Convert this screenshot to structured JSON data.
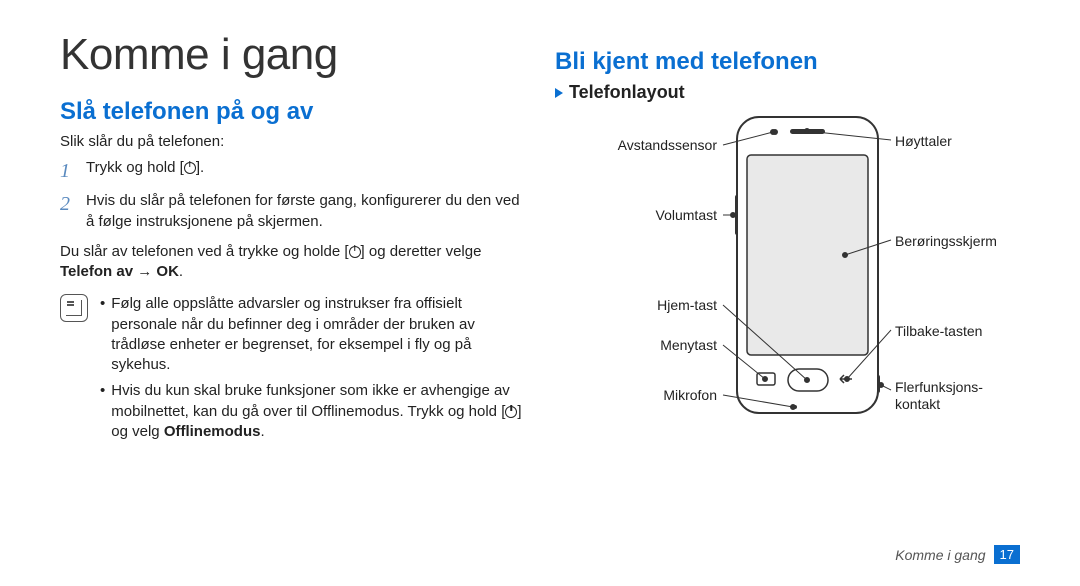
{
  "header": {
    "title": "Komme i gang"
  },
  "left": {
    "section_title": "Slå telefonen på og av",
    "intro": "Slik slår du på telefonen:",
    "step1": "Trykk og hold [",
    "step1_after": "].",
    "step2": "Hvis du slår på telefonen for første gang, konfigurerer du den ved å følge instruksjonene på skjermen.",
    "off_text_pre": "Du slår av telefonen ved å trykke og holde [",
    "off_text_post": "] og deretter velge ",
    "off_bold": "Telefon av → OK",
    "off_period": ".",
    "note1_pre": "Følg alle oppslåtte advarsler og instrukser fra offisielt personale når du befinner deg i områder der bruken av trådløse enheter er begrenset, for eksempel i fly og på sykehus.",
    "note2_pre": "Hvis du kun skal bruke funksjoner som ikke er avhengige av mobilnettet, kan du gå over til Offlinemodus. Trykk og hold [",
    "note2_post": "] og velg ",
    "note2_bold": "Offlinemodus",
    "note2_period": "."
  },
  "right": {
    "section_title": "Bli kjent med telefonen",
    "sub_title": "Telefonlayout",
    "labels_left": {
      "proximity": "Avstandssensor",
      "volume": "Volumtast",
      "home": "Hjem-tast",
      "menu": "Menytast",
      "mic": "Mikrofon"
    },
    "labels_right": {
      "speaker": "Høyttaler",
      "touch": "Berøringsskjerm",
      "back": "Tilbake-tasten",
      "multijack_l1": "Flerfunksjons-",
      "multijack_l2": "kontakt"
    }
  },
  "footer": {
    "section": "Komme i gang",
    "page": "17"
  }
}
